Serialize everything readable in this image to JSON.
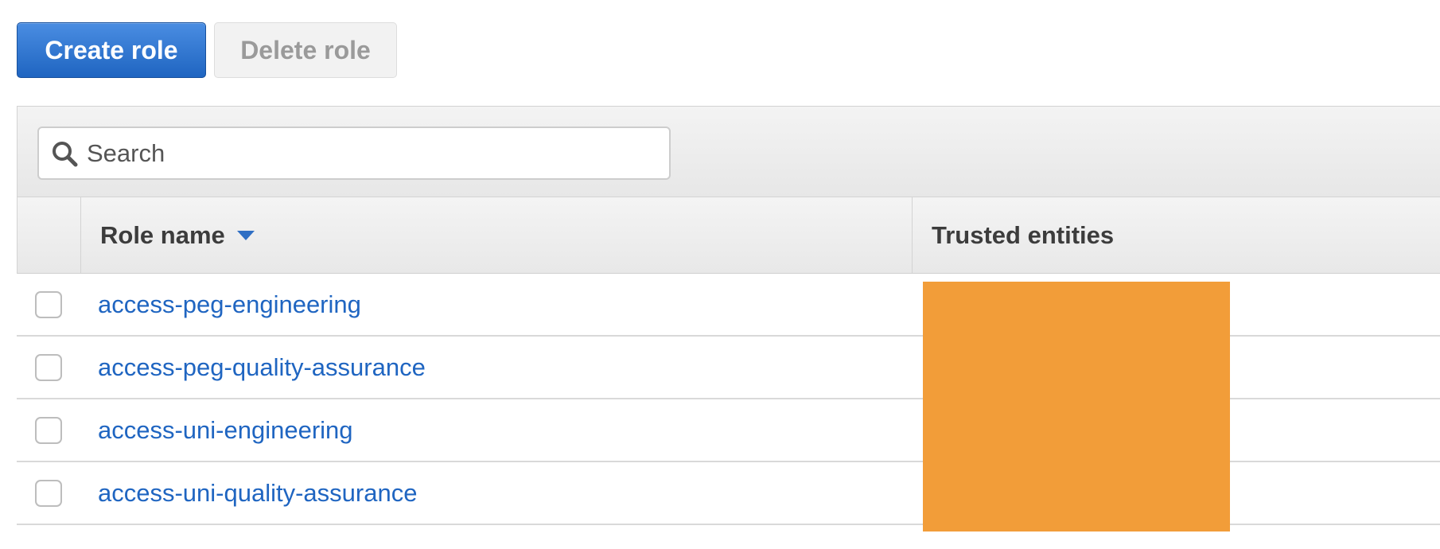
{
  "toolbar": {
    "create_label": "Create role",
    "delete_label": "Delete role"
  },
  "search": {
    "placeholder": "Search",
    "value": ""
  },
  "table": {
    "columns": {
      "role_name": "Role name",
      "trusted_entities": "Trusted entities"
    },
    "sort": "descending",
    "rows": [
      {
        "role_name": "access-peg-engineering",
        "trusted_entities": ""
      },
      {
        "role_name": "access-peg-quality-assurance",
        "trusted_entities": ""
      },
      {
        "role_name": "access-uni-engineering",
        "trusted_entities": ""
      },
      {
        "role_name": "access-uni-quality-assurance",
        "trusted_entities": ""
      }
    ]
  },
  "icons": {
    "search": "search-icon",
    "sort": "caret-down-icon"
  },
  "colors": {
    "primary": "#1f65c1",
    "link": "#1f65c1",
    "redaction": "#f29d39",
    "disabled_text": "#9a9a9a"
  }
}
